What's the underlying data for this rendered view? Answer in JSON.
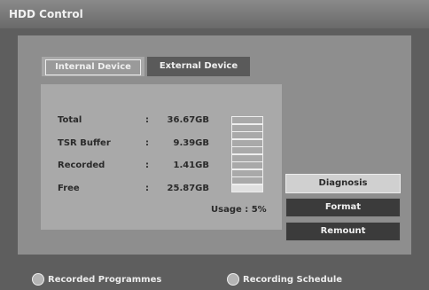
{
  "window": {
    "title": "HDD Control"
  },
  "tabs": [
    {
      "label": "Internal Device",
      "active": true
    },
    {
      "label": "External Device",
      "active": false
    }
  ],
  "stats": [
    {
      "label": "Total",
      "value": "36.67GB"
    },
    {
      "label": "TSR Buffer",
      "value": "9.39GB"
    },
    {
      "label": "Recorded",
      "value": "1.41GB"
    },
    {
      "label": "Free",
      "value": "25.87GB"
    }
  ],
  "separator": ":",
  "usage": {
    "label": "Usage : 5%",
    "fraction": 0.05,
    "segments": 10
  },
  "buttons": {
    "diagnosis": "Diagnosis",
    "format": "Format",
    "remount": "Remount"
  },
  "footer": {
    "recorded": "Recorded Programmes",
    "schedule": "Recording Schedule"
  }
}
